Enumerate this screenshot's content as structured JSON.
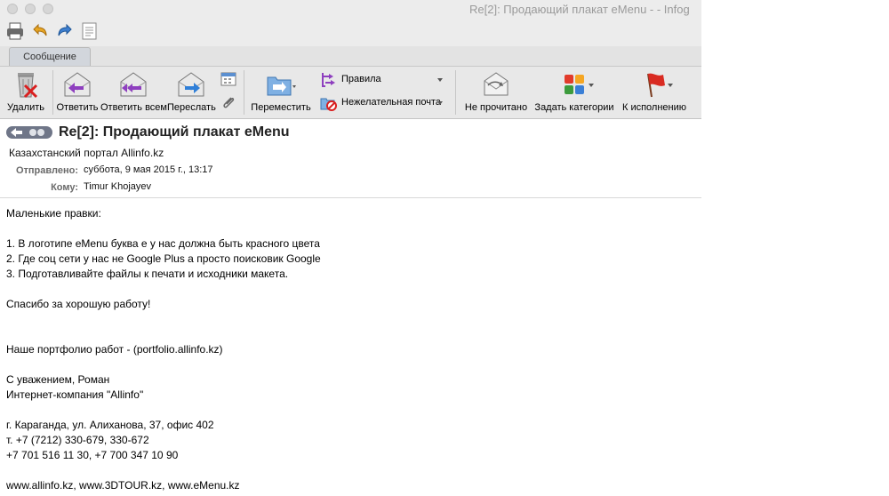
{
  "window": {
    "title": "Re[2]: Продающий плакат eMenu - - Infog"
  },
  "quick_toolbar": {
    "icons": [
      "print-icon",
      "undo-icon",
      "redo-icon",
      "customize-toolbar-icon"
    ]
  },
  "tab": {
    "label": "Сообщение"
  },
  "ribbon": {
    "delete": "Удалить",
    "reply": "Ответить",
    "reply_all": "Ответить всем",
    "forward": "Переслать",
    "move": "Переместить",
    "rules": "Правила",
    "junk": "Нежелательная почта",
    "unread": "Не прочитано",
    "categories": "Задать категории",
    "followup": "К исполнению"
  },
  "message": {
    "subject": "Re[2]: Продающий плакат eMenu",
    "sender": "Казахстанский портал Allinfo.kz",
    "sent_label": "Отправлено:",
    "sent_value": "суббота, 9 мая 2015 г., 13:17",
    "to_label": "Кому:",
    "to_value": "Timur Khojayev"
  },
  "body_lines": [
    "Маленькие правки:",
    "",
    "1. В логотипе eMenu буква e у нас должна быть красного цвета",
    "2. Где соц сети у нас не Google Plus а просто поисковик Google",
    "3. Подготавливайте файлы к печати и исходники макета.",
    "",
    "Спасибо за хорошую работу!",
    "",
    "",
    "Наше портфолио работ - (portfolio.allinfo.kz)",
    "",
    "С уважением, Роман",
    "Интернет-компания \"Allinfo\"",
    "",
    "г. Караганда, ул. Алиханова, 37, офис 402",
    "т. +7 (7212) 330-679, 330-672",
    "+7 701 516 11 30, +7 700 347 10 90",
    "",
    "www.allinfo.kz, www.3DTOUR.kz, www.eMenu.kz"
  ]
}
